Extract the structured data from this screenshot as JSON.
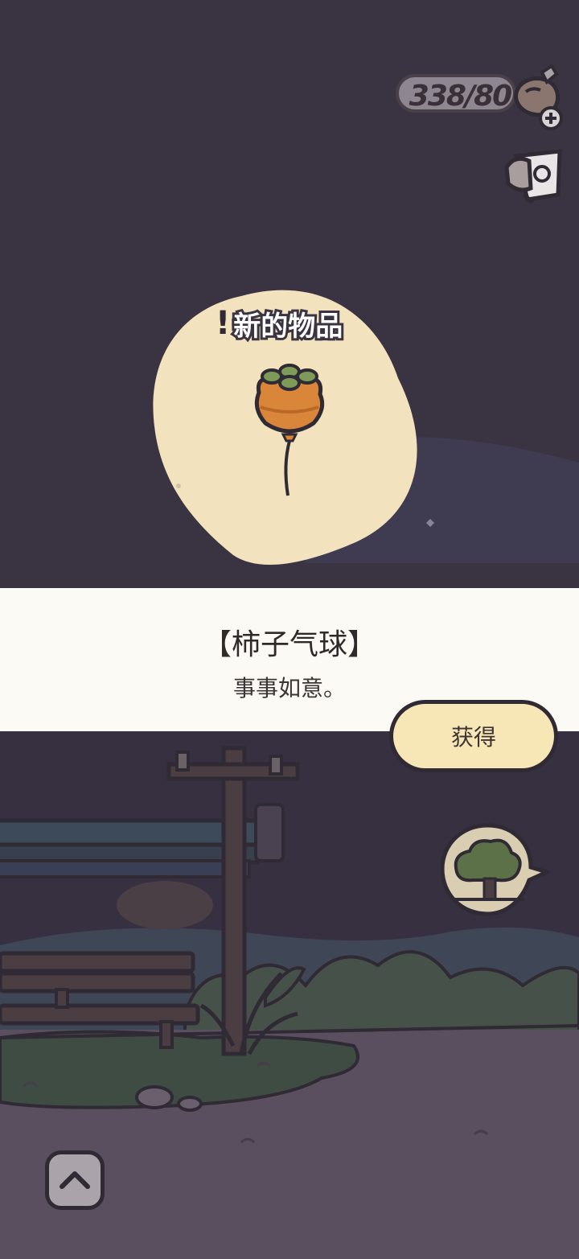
{
  "hud": {
    "currency_value": "338/80",
    "currency_icon": "acorn-pouch-icon",
    "add_icon": "plus-icon",
    "notes_icon": "note-card-icon"
  },
  "popup": {
    "new_item_label": "新的物品",
    "item_icon": "persimmon-balloon-icon",
    "item_name": "【柿子气球】",
    "item_description": "事事如意。",
    "obtain_button": "获得"
  },
  "scene": {
    "tree_button_icon": "tree-house-icon",
    "up_button_icon": "chevron-up-icon"
  },
  "colors": {
    "night_sky": "#3a3442",
    "spotlight": "#f2e2bd",
    "panel": "#fcfaf4",
    "button": "#f8e7b6",
    "ground": "#5a4f5e"
  }
}
